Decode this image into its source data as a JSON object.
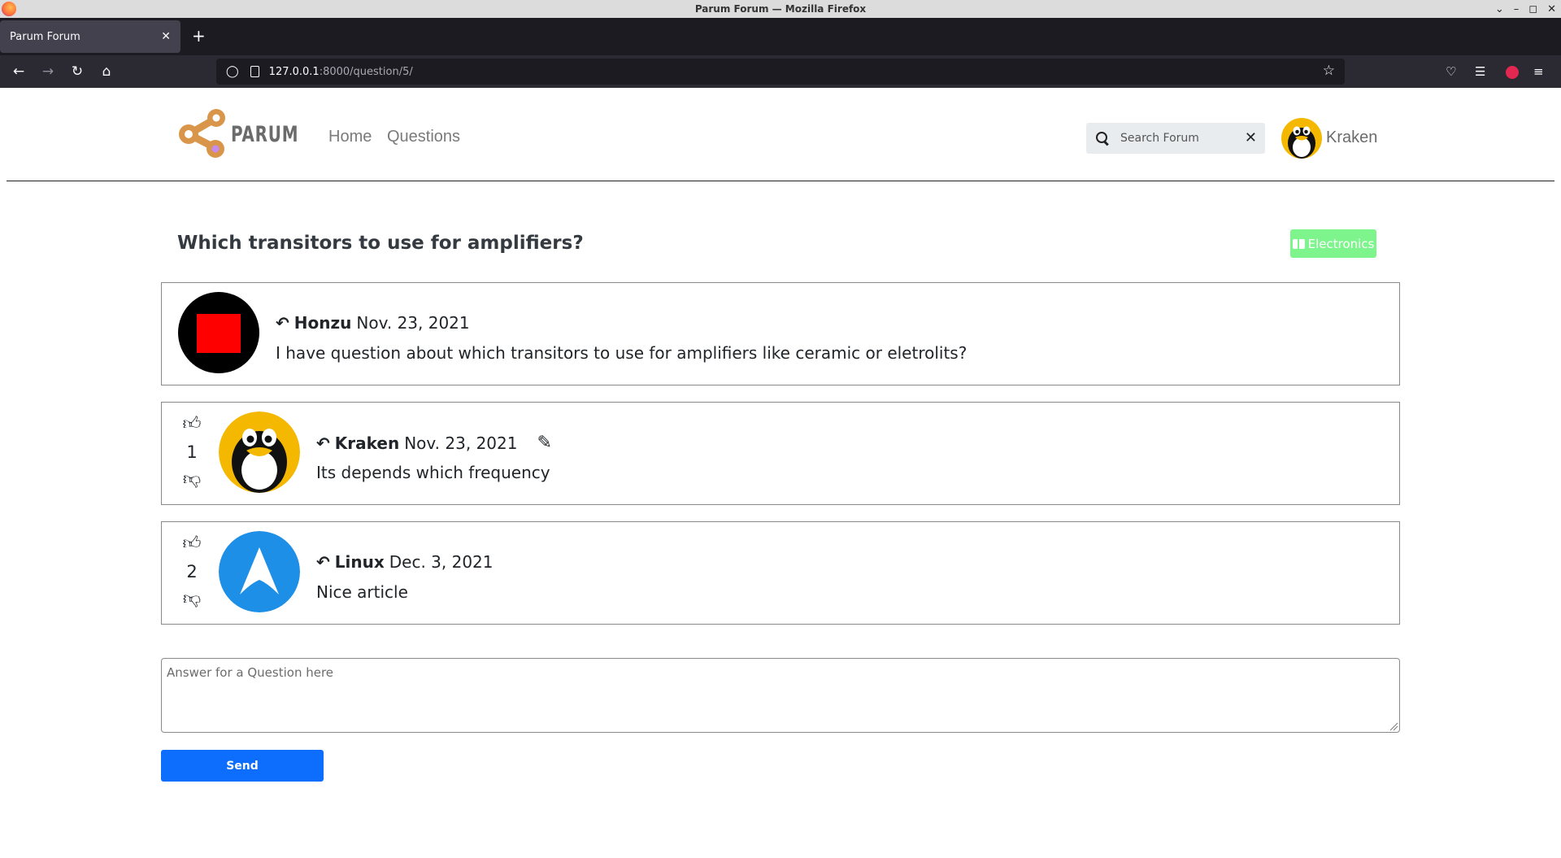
{
  "browser": {
    "window_title": "Parum Forum — Mozilla Firefox",
    "tab_title": "Parum Forum",
    "url_host": "127.0.0.1",
    "url_path": ":8000/question/5/"
  },
  "site": {
    "brand": "PARUM",
    "nav": [
      "Home",
      "Questions"
    ],
    "search_placeholder": "Search Forum",
    "user_name": "Kraken"
  },
  "question": {
    "title": "Which transitors to use for amplifiers?",
    "category": "Electronics",
    "author": "Honzu",
    "date": "Nov. 23, 2021",
    "body": "I have question about which transitors to use for amplifiers like ceramic or eletrolits?"
  },
  "answers": [
    {
      "votes": "1",
      "author": "Kraken",
      "date": "Nov. 23, 2021",
      "body": "Its depends which frequency",
      "editable": true
    },
    {
      "votes": "2",
      "author": "Linux",
      "date": "Dec. 3, 2021",
      "body": "Nice article",
      "editable": false
    }
  ],
  "answer_form": {
    "placeholder": "Answer for a Question here",
    "send_label": "Send"
  },
  "colors": {
    "send_button": "#0d6efd",
    "category_badge": "#7ef58c",
    "logo_orange": "#d9964a"
  }
}
